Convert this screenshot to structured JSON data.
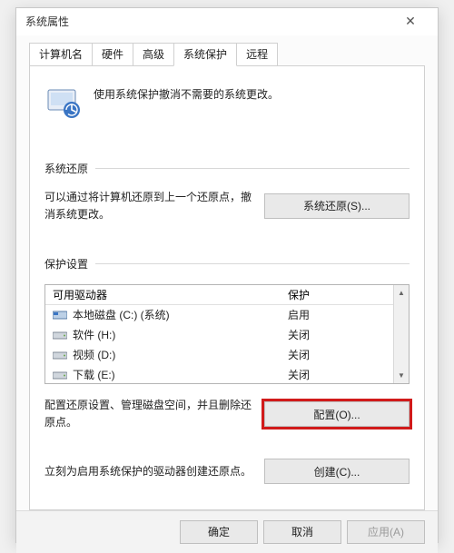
{
  "window": {
    "title": "系统属性"
  },
  "tabs": [
    {
      "label": "计算机名"
    },
    {
      "label": "硬件"
    },
    {
      "label": "高级"
    },
    {
      "label": "系统保护"
    },
    {
      "label": "远程"
    }
  ],
  "active_tab_index": 3,
  "intro": {
    "text": "使用系统保护撤消不需要的系统更改。"
  },
  "sections": {
    "restore": {
      "header": "系统还原",
      "desc": "可以通过将计算机还原到上一个还原点，撤消系统更改。",
      "button": "系统还原(S)..."
    },
    "settings": {
      "header": "保护设置",
      "columns": {
        "drive": "可用驱动器",
        "protection": "保护"
      },
      "drives": [
        {
          "icon": "os-disk",
          "name": "本地磁盘 (C:) (系统)",
          "protection": "启用"
        },
        {
          "icon": "disk",
          "name": "软件 (H:)",
          "protection": "关闭"
        },
        {
          "icon": "disk",
          "name": "视频 (D:)",
          "protection": "关闭"
        },
        {
          "icon": "disk",
          "name": "下载 (E:)",
          "protection": "关闭"
        }
      ],
      "configure_desc": "配置还原设置、管理磁盘空间，并且删除还原点。",
      "configure_button": "配置(O)...",
      "create_desc": "立刻为启用系统保护的驱动器创建还原点。",
      "create_button": "创建(C)..."
    }
  },
  "footer": {
    "ok": "确定",
    "cancel": "取消",
    "apply": "应用(A)"
  }
}
